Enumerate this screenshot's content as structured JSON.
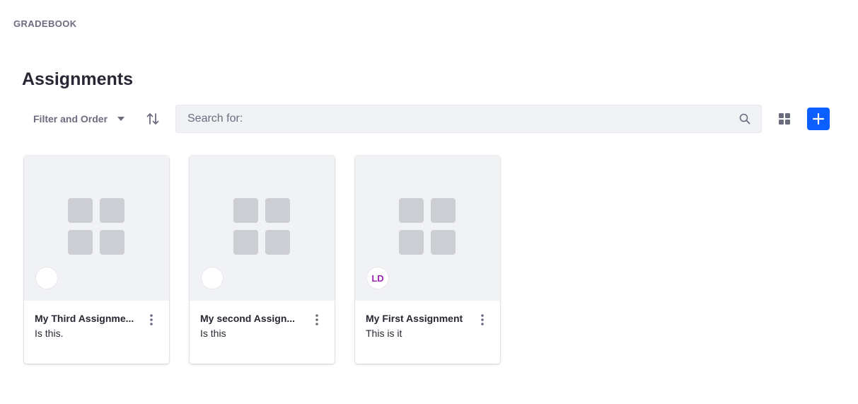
{
  "header": {
    "app_label": "GRADEBOOK"
  },
  "page": {
    "title": "Assignments"
  },
  "toolbar": {
    "filter_label": "Filter and Order",
    "sort_icon": "sort-arrows-icon",
    "search_placeholder": "Search for:",
    "search_icon": "search-icon",
    "view_icon": "grid-view-icon",
    "add_icon": "plus-icon",
    "accent_color": "#0b5fff"
  },
  "cards": [
    {
      "title": "My Third Assignme...",
      "subtitle": "Is this.",
      "avatar_initials": ""
    },
    {
      "title": "My second Assign...",
      "subtitle": "Is this",
      "avatar_initials": ""
    },
    {
      "title": "My First Assignment",
      "subtitle": "This is it",
      "avatar_initials": "LD"
    }
  ]
}
